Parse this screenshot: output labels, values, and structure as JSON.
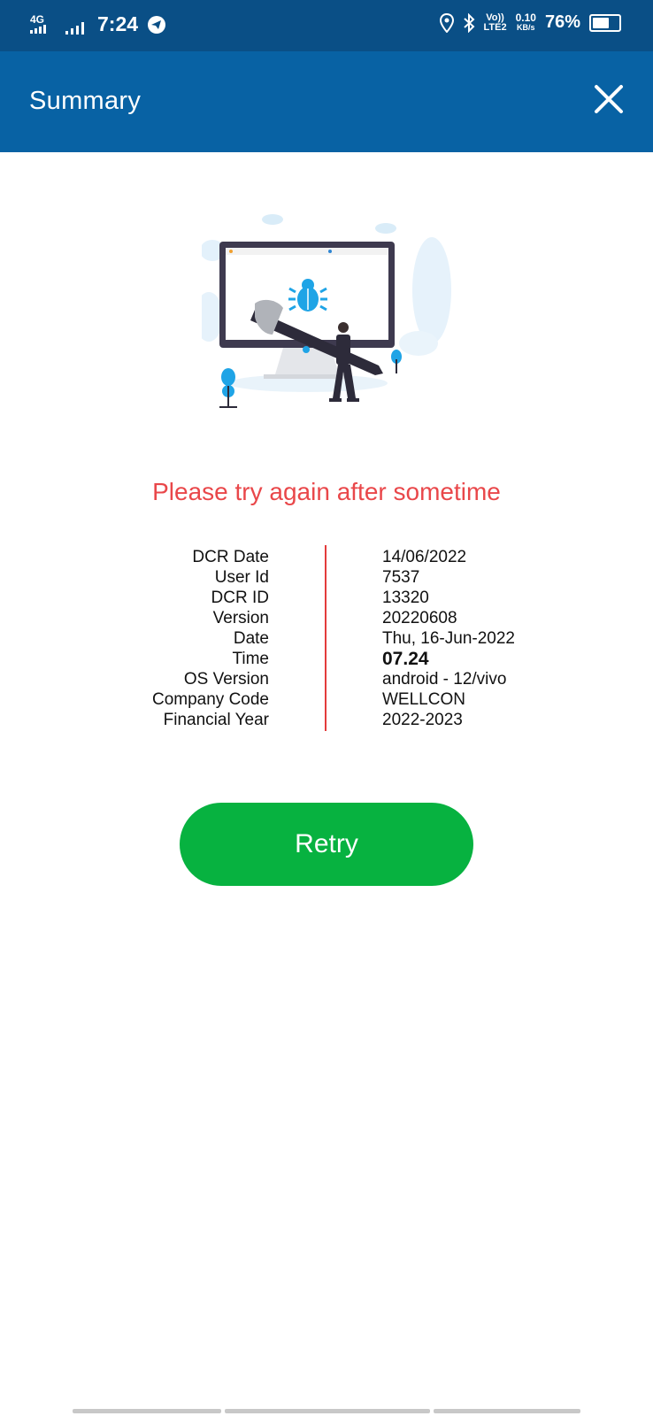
{
  "status_bar": {
    "network_type": "4G",
    "time": "7:24",
    "volte_top": "Vo))",
    "volte_bottom": "LTE2",
    "speed_top": "0.10",
    "speed_bottom": "KB/s",
    "battery": "76%",
    "battery_level": 0.76,
    "icons": [
      "signal-icon",
      "signal-icon",
      "telegram-icon",
      "location-icon",
      "bluetooth-icon",
      "battery-icon"
    ]
  },
  "header": {
    "title": "Summary",
    "close_icon": "close-icon",
    "colors": {
      "status_bar": "#0a4f86",
      "app_bar": "#0862a4"
    }
  },
  "main": {
    "illustration_icon": "bug-fix-illustration",
    "error_message": "Please try again after sometime",
    "error_color": "#e9474a",
    "details": [
      {
        "label": "DCR Date",
        "value": "14/06/2022"
      },
      {
        "label": "User Id",
        "value": "7537"
      },
      {
        "label": "DCR ID",
        "value": "13320"
      },
      {
        "label": "Version",
        "value": "20220608"
      },
      {
        "label": "Date",
        "value": "Thu, 16-Jun-2022"
      },
      {
        "label": "Time",
        "value": "07.24"
      },
      {
        "label": "OS Version",
        "value": "android - 12/vivo"
      },
      {
        "label": "Company Code",
        "value": "WELLCON"
      },
      {
        "label": "Financial Year",
        "value": "2022-2023"
      }
    ],
    "retry_label": "Retry",
    "retry_color": "#07b240"
  }
}
